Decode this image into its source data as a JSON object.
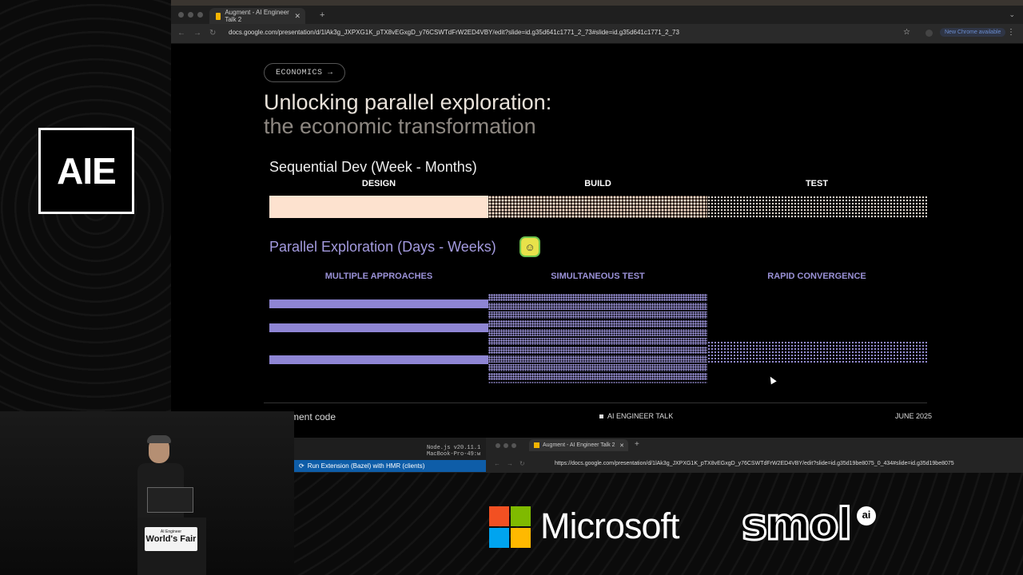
{
  "event": {
    "logo_text": "AIE",
    "podium_small": "AI Engineer",
    "podium_big": "World's Fair"
  },
  "browser": {
    "tab_title": "Augment - AI Engineer Talk 2",
    "new_tab": "+",
    "url": "docs.google.com/presentation/d/1lAk3g_JXPXG1K_pTX8vEGxgD_y76CSWTdFrW2ED4VBY/edit?slide=id.g35d641c1771_2_73#slide=id.g35d641c1771_2_73",
    "update_label": "New Chrome available",
    "kebab": "⋮",
    "star": "☆"
  },
  "slide": {
    "tag": "ECONOMICS →",
    "title_line1": "Unlocking parallel exploration:",
    "title_line2": "the economic transformation",
    "sequential": {
      "title": "Sequential Dev (Week - Months)",
      "phases": [
        "DESIGN",
        "BUILD",
        "TEST"
      ]
    },
    "parallel": {
      "title": "Parallel Exploration (Days - Weeks)",
      "icon": "robot-icon",
      "phases": [
        "MULTIPLE APPROACHES",
        "SIMULTANEOUS TEST",
        "RAPID CONVERGENCE"
      ]
    },
    "footer": {
      "brand": "ment code",
      "center": "AI ENGINEER TALK",
      "date": "JUNE 2025"
    },
    "colors": {
      "peach": "#fde2cf",
      "purple": "#8e85d4"
    }
  },
  "lower": {
    "code_line1": "Node.js v20.11.1",
    "code_line2": "MacBook-Pro-49:w",
    "run_label": "Run Extension (Bazel) with HMR (clients)",
    "browser2_tab": "Augment - AI Engineer Talk 2",
    "browser2_url": "https://docs.google.com/presentation/d/1lAk3g_JXPXG1K_pTX8vEGxgD_y76CSWTdFrW2ED4VBY/edit?slide=id.g35d19be8075_0_434#slide=id.g35d19be8075"
  },
  "sponsors": {
    "microsoft": "Microsoft",
    "smol": "smol",
    "smol_ai": "ai"
  }
}
